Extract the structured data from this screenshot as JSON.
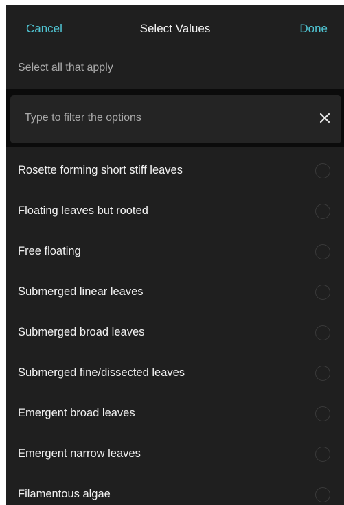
{
  "header": {
    "cancel_label": "Cancel",
    "title": "Select Values",
    "done_label": "Done"
  },
  "subtitle": "Select all that apply",
  "filter": {
    "placeholder": "Type to filter the options",
    "value": "",
    "clear_icon": "close-icon"
  },
  "options": [
    {
      "label": "Rosette forming short stiff leaves",
      "selected": false
    },
    {
      "label": "Floating leaves but rooted",
      "selected": false
    },
    {
      "label": "Free floating",
      "selected": false
    },
    {
      "label": "Submerged linear leaves",
      "selected": false
    },
    {
      "label": "Submerged broad leaves",
      "selected": false
    },
    {
      "label": "Submerged fine/dissected leaves",
      "selected": false
    },
    {
      "label": "Emergent broad leaves",
      "selected": false
    },
    {
      "label": "Emergent narrow leaves",
      "selected": false
    },
    {
      "label": "Filamentous algae",
      "selected": false
    }
  ],
  "colors": {
    "background": "#1f1f1f",
    "accent": "#4fc3d1",
    "filter_band": "#0b0b0b",
    "radio_border": "#3a3a3a"
  }
}
